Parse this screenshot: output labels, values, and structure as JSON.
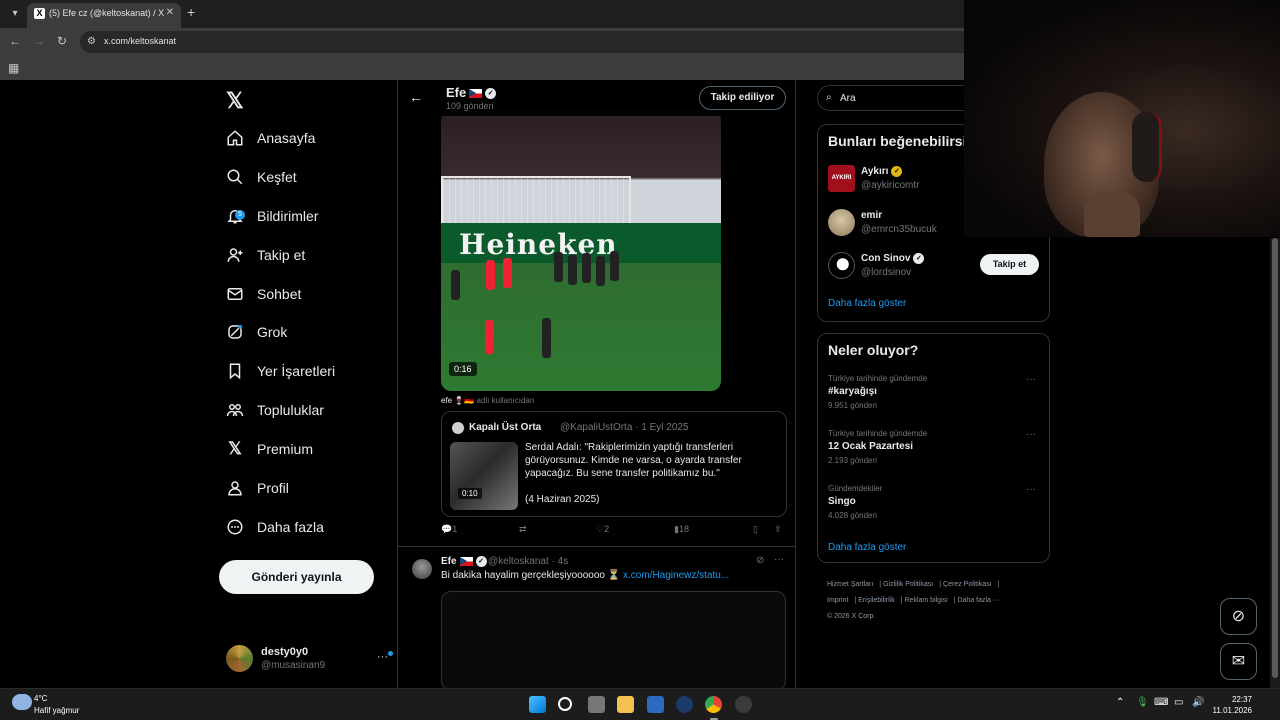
{
  "browser": {
    "tab_title": "(5) Efe cz (@keltoskanat) / X",
    "url": "x.com/keltoskanat"
  },
  "nav": {
    "items": [
      {
        "label": "Anasayfa",
        "icon": "home-icon"
      },
      {
        "label": "Keşfet",
        "icon": "search-icon"
      },
      {
        "label": "Bildirimler",
        "icon": "bell-icon",
        "badge": "5"
      },
      {
        "label": "Takip et",
        "icon": "follow-icon"
      },
      {
        "label": "Sohbet",
        "icon": "mail-icon"
      },
      {
        "label": "Grok",
        "icon": "grok-icon"
      },
      {
        "label": "Yer İşaretleri",
        "icon": "bookmark-icon"
      },
      {
        "label": "Topluluklar",
        "icon": "communities-icon"
      },
      {
        "label": "Premium",
        "icon": "x-icon"
      },
      {
        "label": "Profil",
        "icon": "profile-icon"
      },
      {
        "label": "Daha fazla",
        "icon": "more-icon"
      }
    ],
    "post_button": "Gönderi yayınla",
    "account": {
      "name": "desty0y0",
      "handle": "@musasinan9"
    }
  },
  "profile_header": {
    "name": "Efe",
    "count": "109 gönderi",
    "follow_state": "Takip ediliyor"
  },
  "tweet1": {
    "video_time": "0:16",
    "video_banner": "Heineken",
    "from_user": "efe",
    "from_suffix": "adlı kullanıcıdan",
    "quote": {
      "name": "Kapalı Üst Orta",
      "handle_date": "@KapaliUstOrta · 1 Eyl 2025",
      "thumb_time": "0:10",
      "text": "Serdal Adalı: \"Rakiplerimizin yaptığı transferleri görüyorsunuz. Kimde ne varsa, o ayarda transfer yapacağız. Bu sene transfer politikamız bu.\"",
      "date_note": "(4 Haziran 2025)"
    },
    "replies": "1",
    "likes": "2",
    "views": "18"
  },
  "tweet2": {
    "name": "Efe",
    "handle_time": "@keltoskanat · 4s",
    "text": "Bi dakika hayalim gerçekleşiyoooooo ⏳",
    "link": "x.com/Haginewz/statu..."
  },
  "right": {
    "search_placeholder": "Ara",
    "suggest_title": "Bunları beğenebilirsi",
    "suggestions": [
      {
        "name": "Aykırı",
        "handle": "@aykiricomtr",
        "logo": "AYKIRI"
      },
      {
        "name": "emir",
        "handle": "@emrcn35bucuk"
      },
      {
        "name": "Con Sinov",
        "handle": "@lordsinov",
        "button": "Takip et"
      }
    ],
    "show_more": "Daha fazla göster",
    "trends_title": "Neler oluyor?",
    "trends": [
      {
        "context": "Türkiye tarihinde gündemde",
        "topic": "#karyağışı",
        "count": "9.951 gönderi"
      },
      {
        "context": "Türkiye tarihinde gündemde",
        "topic": "12 Ocak Pazartesi",
        "count": "2.193 gönderi"
      },
      {
        "context": "Gündemdekiler",
        "topic": "Singo",
        "count": "4.028 gönderi"
      }
    ],
    "trends_more": "Daha fazla göster",
    "footer": [
      "Hizmet Şartları",
      "Gizlilik Politikası",
      "Çerez Politikası",
      "Imprint",
      "Erişilebilirlik",
      "Reklam bilgisi",
      "Daha fazla ···",
      "© 2026 X Corp."
    ]
  },
  "taskbar": {
    "temp": "4°C",
    "weather": "Hafif yağmur",
    "time": "22:37",
    "date": "11.01.2026"
  },
  "colors": {
    "accent": "#1d9bf0",
    "border": "#2f3336",
    "muted": "#71767b"
  }
}
